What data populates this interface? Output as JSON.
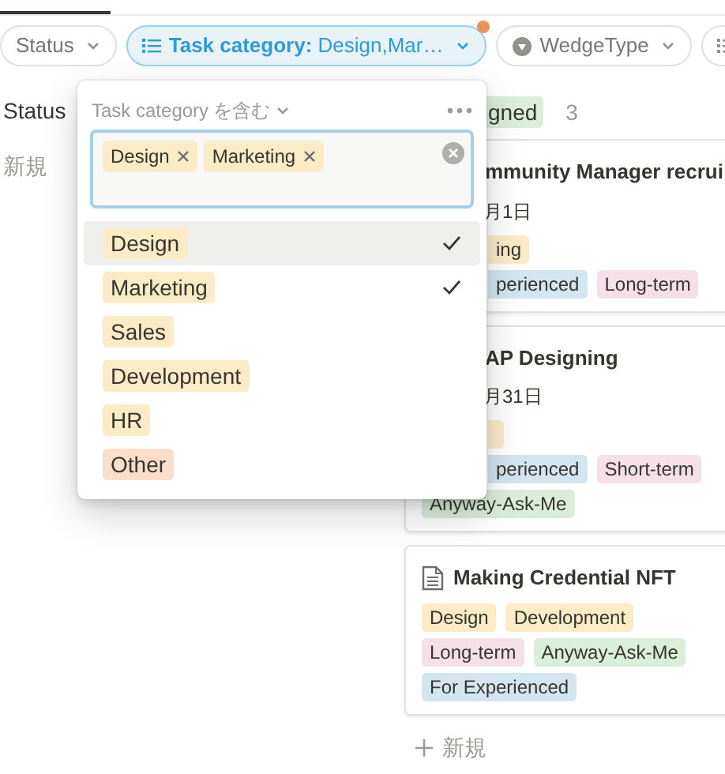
{
  "filters": [
    {
      "kind": "plain",
      "label": "Status",
      "active": false
    },
    {
      "kind": "list",
      "label": "**Task category:** Design,Mar…",
      "active": true,
      "modified": true
    },
    {
      "kind": "tag",
      "label": "WedgeType",
      "active": false
    },
    {
      "kind": "list",
      "active": false
    }
  ],
  "left_column": {
    "group_label": "Status",
    "new_label": "新規"
  },
  "board": {
    "group_tag": "gned",
    "count": "3",
    "cards": [
      {
        "has_icon": false,
        "title": "mmunity Manager recrui",
        "clipped": true,
        "date": "月1日",
        "tag_rows": [
          [
            {
              "label": "ing",
              "color": "#fbecc7",
              "clipped": true
            }
          ],
          [
            {
              "label": "perienced",
              "color": "#d3e5ef",
              "clipped": true
            },
            {
              "label": "Long-term",
              "color": "#f5e0e9",
              "clipped": false
            }
          ]
        ]
      },
      {
        "has_icon": false,
        "title": "AP Designing",
        "clipped": true,
        "date": "月31日",
        "tag_rows": [
          [
            {
              "color": "#fbecc7",
              "clipped": true
            }
          ],
          [
            {
              "label": "perienced",
              "color": "#d3e5ef",
              "clipped": true
            },
            {
              "label": "Short-term",
              "color": "#f5e0e9",
              "clipped": false
            }
          ],
          [
            {
              "label": "Anyway-Ask-Me",
              "color": "#dbeddb",
              "clipped": false
            }
          ]
        ]
      },
      {
        "has_icon": true,
        "title": "Making Credential NFT",
        "clipped": false,
        "tag_rows": [
          [
            {
              "label": "Design",
              "color": "#fbecc7",
              "clipped": false
            },
            {
              "label": "Development",
              "color": "#fbecc7",
              "clipped": false
            }
          ],
          [
            {
              "label": "Long-term",
              "color": "#f5e0e9",
              "clipped": false
            },
            {
              "label": "Anyway-Ask-Me",
              "color": "#dbeddb",
              "clipped": false
            }
          ],
          [
            {
              "label": "For Experienced",
              "color": "#d3e5ef",
              "clipped": false
            }
          ]
        ]
      }
    ],
    "new_label": "新規"
  },
  "popup": {
    "property": "Task category",
    "condition": "を含む",
    "selected_tags": [
      {
        "label": "Design",
        "color": "#fbecc7"
      },
      {
        "label": "Marketing",
        "color": "#fbecc7"
      }
    ],
    "options": [
      {
        "label": "Design",
        "color": "#fbecc7",
        "checked": true,
        "selected": true
      },
      {
        "label": "Marketing",
        "color": "#fbecc7",
        "checked": true,
        "selected": false
      },
      {
        "label": "Sales",
        "color": "#fbecc7",
        "checked": false,
        "selected": false
      },
      {
        "label": "Development",
        "color": "#fbecc7",
        "checked": false,
        "selected": false
      },
      {
        "label": "HR",
        "color": "#fbecc7",
        "checked": false,
        "selected": false
      },
      {
        "label": "Other",
        "color": "#fadec9",
        "checked": false,
        "selected": false
      }
    ]
  }
}
